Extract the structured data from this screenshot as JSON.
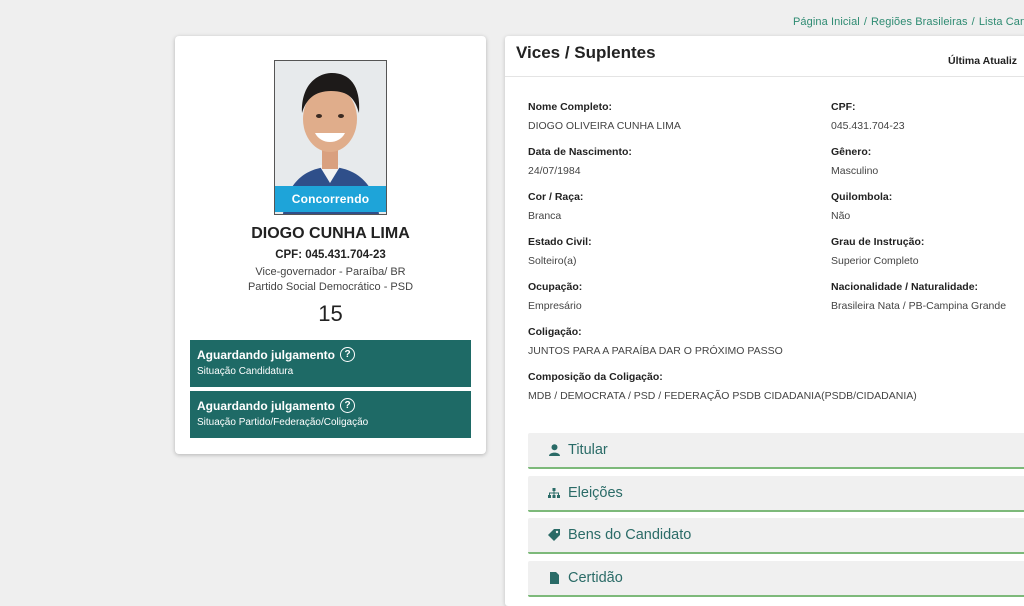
{
  "breadcrumb": {
    "items": [
      "Página Inicial",
      "Regiões Brasileiras",
      "Lista Can"
    ]
  },
  "candidate": {
    "status_pill": "Concorrendo",
    "name": "DIOGO CUNHA LIMA",
    "cpf_line": "CPF: 045.431.704-23",
    "office": "Vice-governador - Paraíba/ BR",
    "party": "Partido Social Democrático - PSD",
    "number": "15",
    "status_candidatura": {
      "title": "Aguardando julgamento",
      "subtitle": "Situação Candidatura"
    },
    "status_partido": {
      "title": "Aguardando julgamento",
      "subtitle": "Situação Partido/Federação/Coligação"
    }
  },
  "panel": {
    "title": "Vices / Suplentes",
    "last_update": "Última Atualiz"
  },
  "fields": {
    "nome": {
      "label": "Nome Completo:",
      "value": "DIOGO OLIVEIRA CUNHA LIMA"
    },
    "cpf": {
      "label": "CPF:",
      "value": "045.431.704-23"
    },
    "nascimento": {
      "label": "Data de Nascimento:",
      "value": "24/07/1984"
    },
    "genero": {
      "label": "Gênero:",
      "value": "Masculino"
    },
    "cor": {
      "label": "Cor / Raça:",
      "value": "Branca"
    },
    "quilombola": {
      "label": "Quilombola:",
      "value": "Não"
    },
    "estado_civil": {
      "label": "Estado Civil:",
      "value": "Solteiro(a)"
    },
    "instrucao": {
      "label": "Grau de Instrução:",
      "value": "Superior Completo"
    },
    "ocupacao": {
      "label": "Ocupação:",
      "value": "Empresário"
    },
    "nacionalidade": {
      "label": "Nacionalidade / Naturalidade:",
      "value": "Brasileira Nata / PB-Campina Grande"
    },
    "coligacao": {
      "label": "Coligação:",
      "value": "JUNTOS PARA A PARAÍBA DAR O PRÓXIMO PASSO"
    },
    "composicao": {
      "label": "Composição da Coligação:",
      "value": "MDB / DEMOCRATA / PSD / FEDERAÇÃO PSDB CIDADANIA(PSDB/CIDADANIA)"
    }
  },
  "accordions": {
    "titular": "Titular",
    "eleicoes": "Eleições",
    "bens": "Bens do Candidato",
    "certidao": "Certidão"
  },
  "colors": {
    "accent_teal": "#1e6a66",
    "link_green": "#2e8b72",
    "pill_blue": "#1ea4d9",
    "accordion_border": "#7db97a"
  }
}
